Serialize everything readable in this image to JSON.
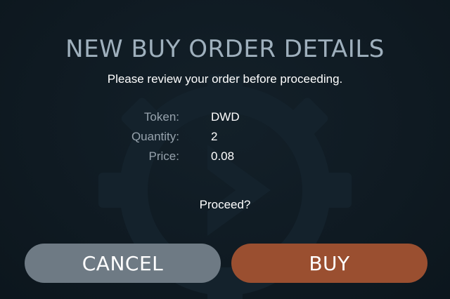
{
  "dialog": {
    "title": "NEW BUY ORDER DETAILS",
    "subtitle": "Please review your order before proceeding.",
    "details": [
      {
        "label": "Token:",
        "value": "DWD"
      },
      {
        "label": "Quantity:",
        "value": "2"
      },
      {
        "label": "Price:",
        "value": "0.08"
      }
    ],
    "prompt": "Proceed?",
    "cancel_label": "CANCEL",
    "buy_label": "BUY"
  },
  "colors": {
    "background": "#0f1a22",
    "title": "#9fb0bd",
    "cancel_button": "#6e7a84",
    "buy_button": "#9a4f30"
  },
  "icons": {
    "watermark": "gear-arrow-icon"
  }
}
